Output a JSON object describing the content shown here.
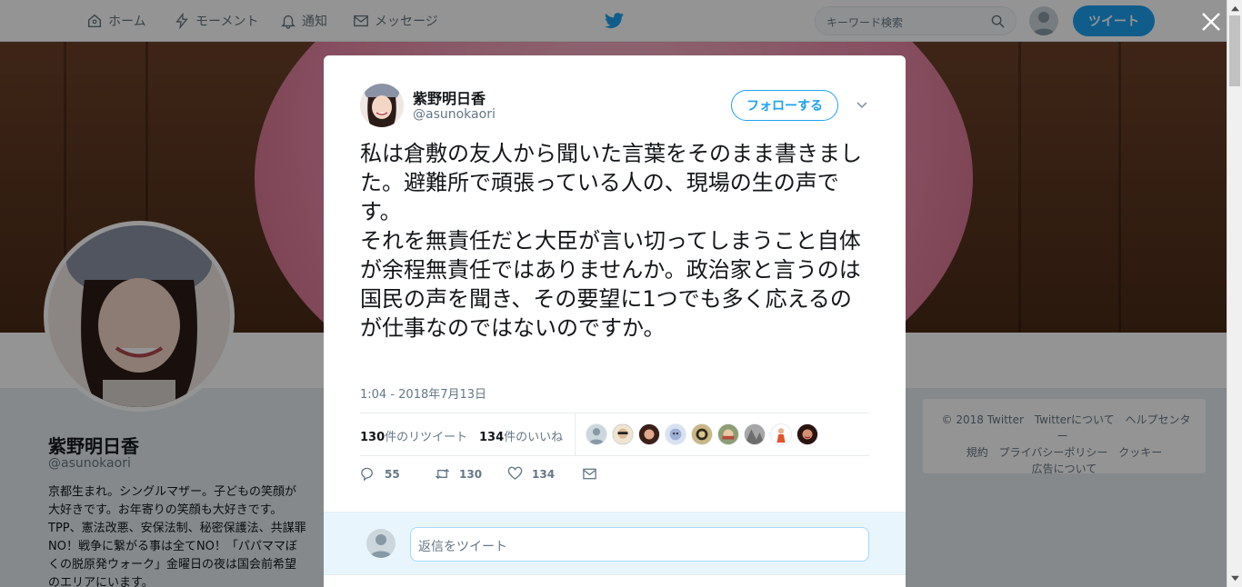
{
  "topnav": {
    "home": "ホーム",
    "moments": "モーメント",
    "notifications": "通知",
    "messages": "メッセージ",
    "search_placeholder": "キーワード検索",
    "tweet_button": "ツイート"
  },
  "profile": {
    "name": "紫野明日香",
    "handle": "@asunokaori",
    "bio": "京都生まれ。シングルマザー。子どもの笑顔が大好きです。お年寄りの笑顔も大好きです。TPP、憲法改悪、安保法制、秘密保護法、共謀罪NO！戦争に繋がる事は全てNO！「パパママぼくの脱原発ウォーク」金曜日の夜は国会前希望のエリアにいます。"
  },
  "footer": {
    "copyright": "© 2018 Twitter",
    "about": "Twitterについて",
    "help": "ヘルプセンター",
    "terms": "規約",
    "privacy": "プライバシーポリシー",
    "cookies": "クッキー",
    "ads": "広告について"
  },
  "tweet": {
    "author_name": "紫野明日香",
    "author_handle": "@asunokaori",
    "follow_label": "フォローする",
    "text": "私は倉敷の友人から聞いた言葉をそのまま書きました。避難所で頑張っている人の、現場の生の声です。\nそれを無責任だと大臣が言い切ってしまうこと自体が余程無責任ではありませんか。政治家と言うのは国民の声を聞き、その要望に1つでも多く応えるのが仕事なのではないのですか。",
    "timestamp": "1:04 - 2018年7月13日",
    "retweet_count": "130",
    "retweet_label": "件のリツイート",
    "like_count": "134",
    "like_label": "件のいいね",
    "reply_action_count": "55",
    "retweet_action_count": "130",
    "like_action_count": "134"
  },
  "reply": {
    "placeholder": "返信をツイート"
  },
  "colors": {
    "brand": "#1da1f2",
    "text": "#14171a",
    "muted": "#657786"
  }
}
